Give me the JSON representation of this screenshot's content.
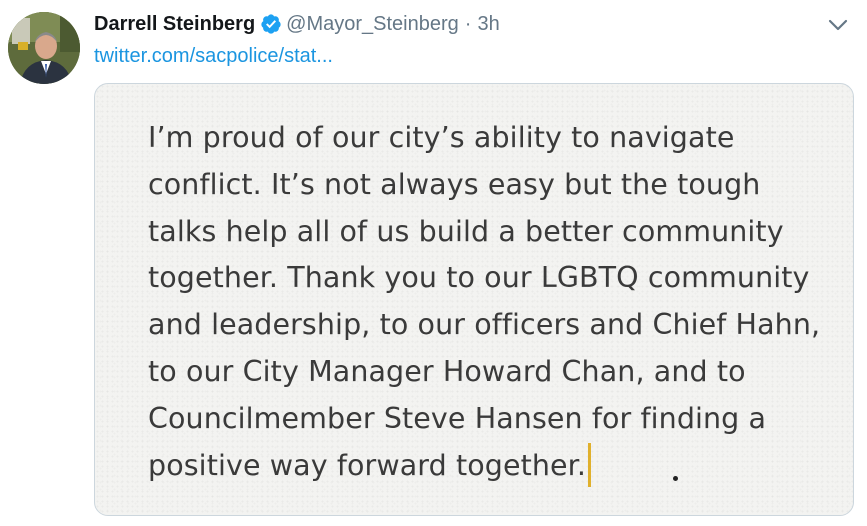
{
  "author": {
    "display_name": "Darrell Steinberg",
    "handle": "@Mayor_Steinberg",
    "separator": "·",
    "time": "3h",
    "verified": true
  },
  "link": {
    "text": "twitter.com/sacpolice/stat..."
  },
  "image_text": {
    "lines": [
      "I’m proud of our city’s ability to navigate",
      "conflict. It’s not always easy but the tough",
      "talks help all of us build a better community",
      "together. Thank you to our LGBTQ community",
      "and leadership, to our officers and Chief Hahn,",
      "to our City Manager Howard Chan, and to",
      "Councilmember Steve Hansen for finding a",
      "positive way forward together."
    ]
  },
  "icons": {
    "verified": "verified-badge-icon",
    "menu": "chevron-down-icon"
  },
  "colors": {
    "name": "#14171a",
    "secondary": "#657786",
    "link": "#1b95e0",
    "verified": "#1da1f2",
    "cursor": "#e0b02c",
    "card_border": "#ccd6dd",
    "card_bg": "#f3f3f1"
  }
}
